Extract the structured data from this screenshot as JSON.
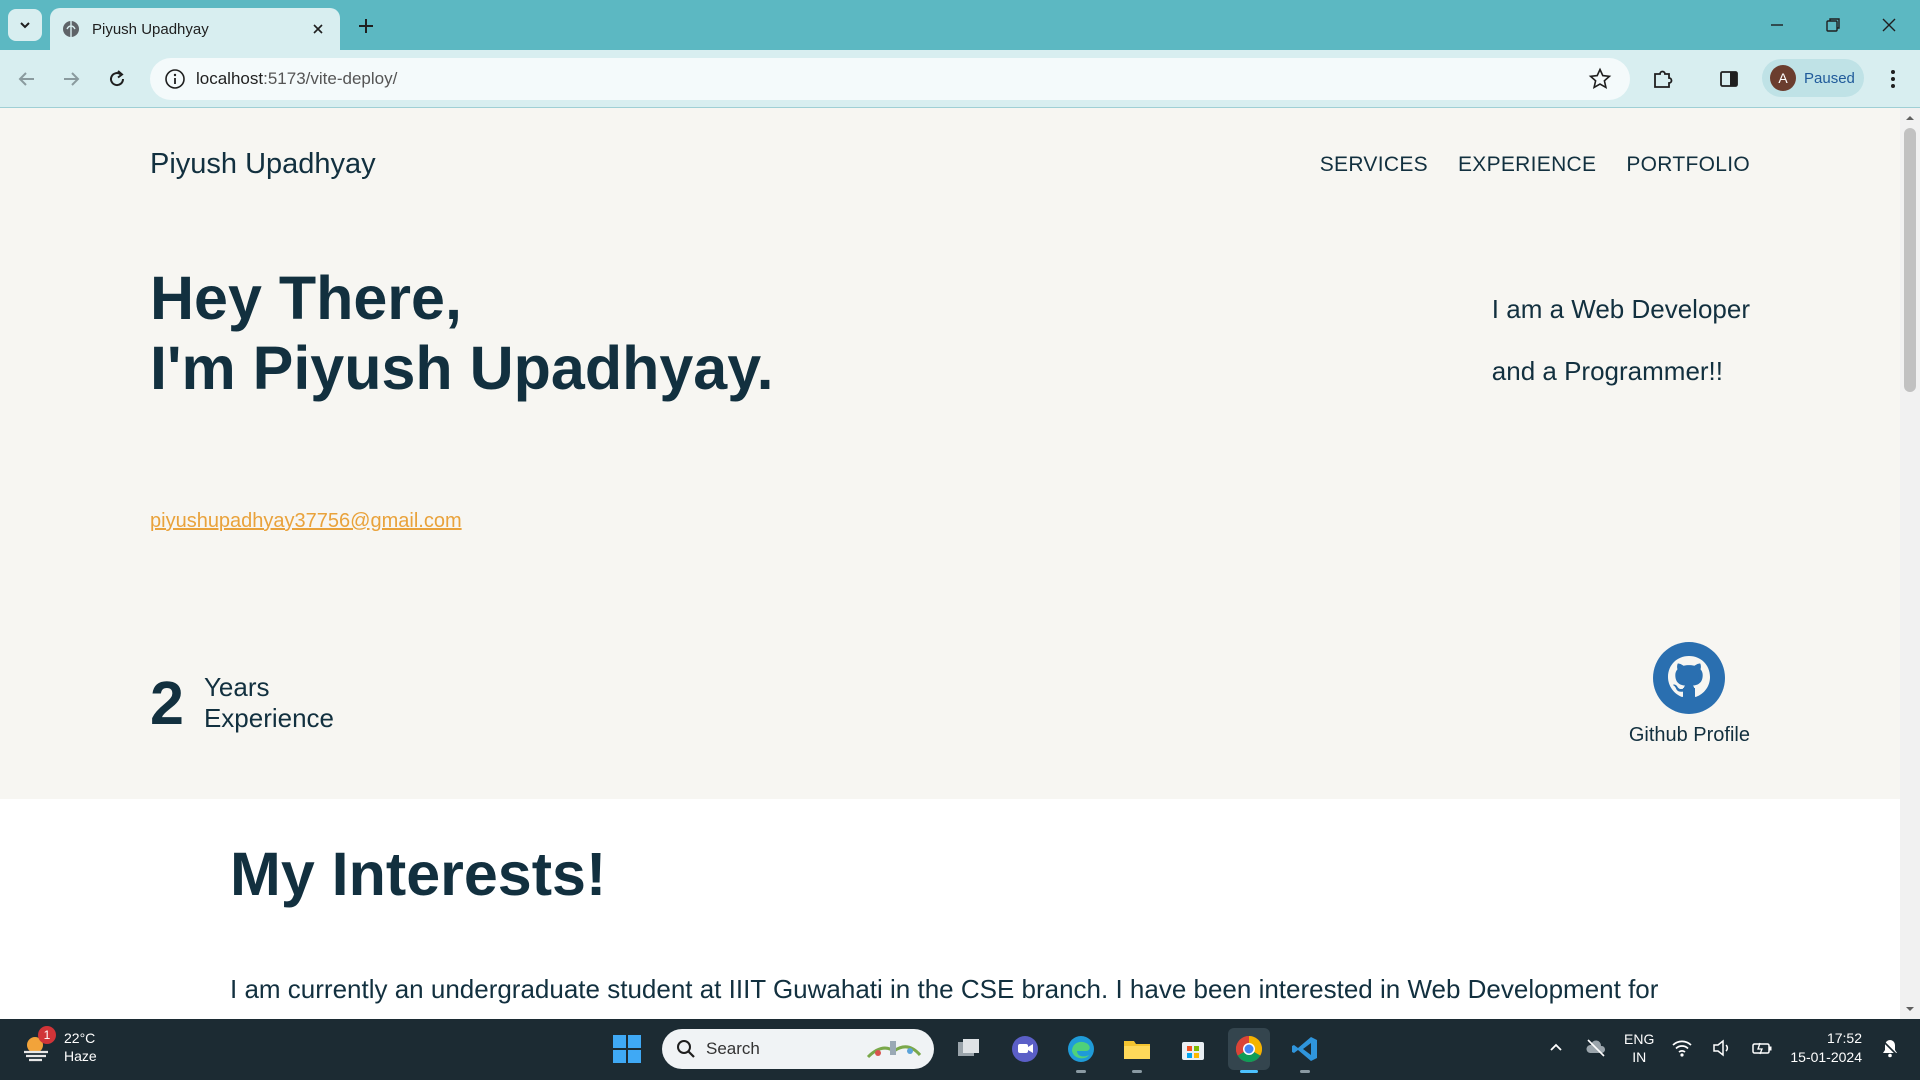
{
  "browser": {
    "tab": {
      "title": "Piyush Upadhyay"
    },
    "url": {
      "host": "localhost",
      "path": ":5173/vite-deploy/"
    },
    "profile": {
      "initial": "A",
      "status": "Paused"
    }
  },
  "page": {
    "brand": "Piyush Upadhyay",
    "nav": [
      "SERVICES",
      "EXPERIENCE",
      "PORTFOLIO"
    ],
    "headline": {
      "line1": "Hey There,",
      "line2": "I'm Piyush Upadhyay."
    },
    "tagline": {
      "line1": "I am a Web Developer",
      "line2": "and a Programmer!!"
    },
    "email": "piyushupadhyay37756@gmail.com",
    "experience": {
      "number": "2",
      "label1": "Years",
      "label2": "Experience"
    },
    "github_label": "Github Profile",
    "interests": {
      "title": "My Interests!",
      "text": "I am currently an undergraduate student at IIIT Guwahati in the CSE branch. I have been interested in Web Development for"
    },
    "colors": {
      "heading": "#12303f",
      "email": "#e9a23b",
      "hero_bg": "#f7f6f2",
      "github": "#2a6fb0"
    }
  },
  "taskbar": {
    "weather": {
      "temp": "22°C",
      "condition": "Haze",
      "badge": "1"
    },
    "search_placeholder": "Search",
    "lang": {
      "line1": "ENG",
      "line2": "IN"
    },
    "time": "17:52",
    "date": "15-01-2024"
  }
}
